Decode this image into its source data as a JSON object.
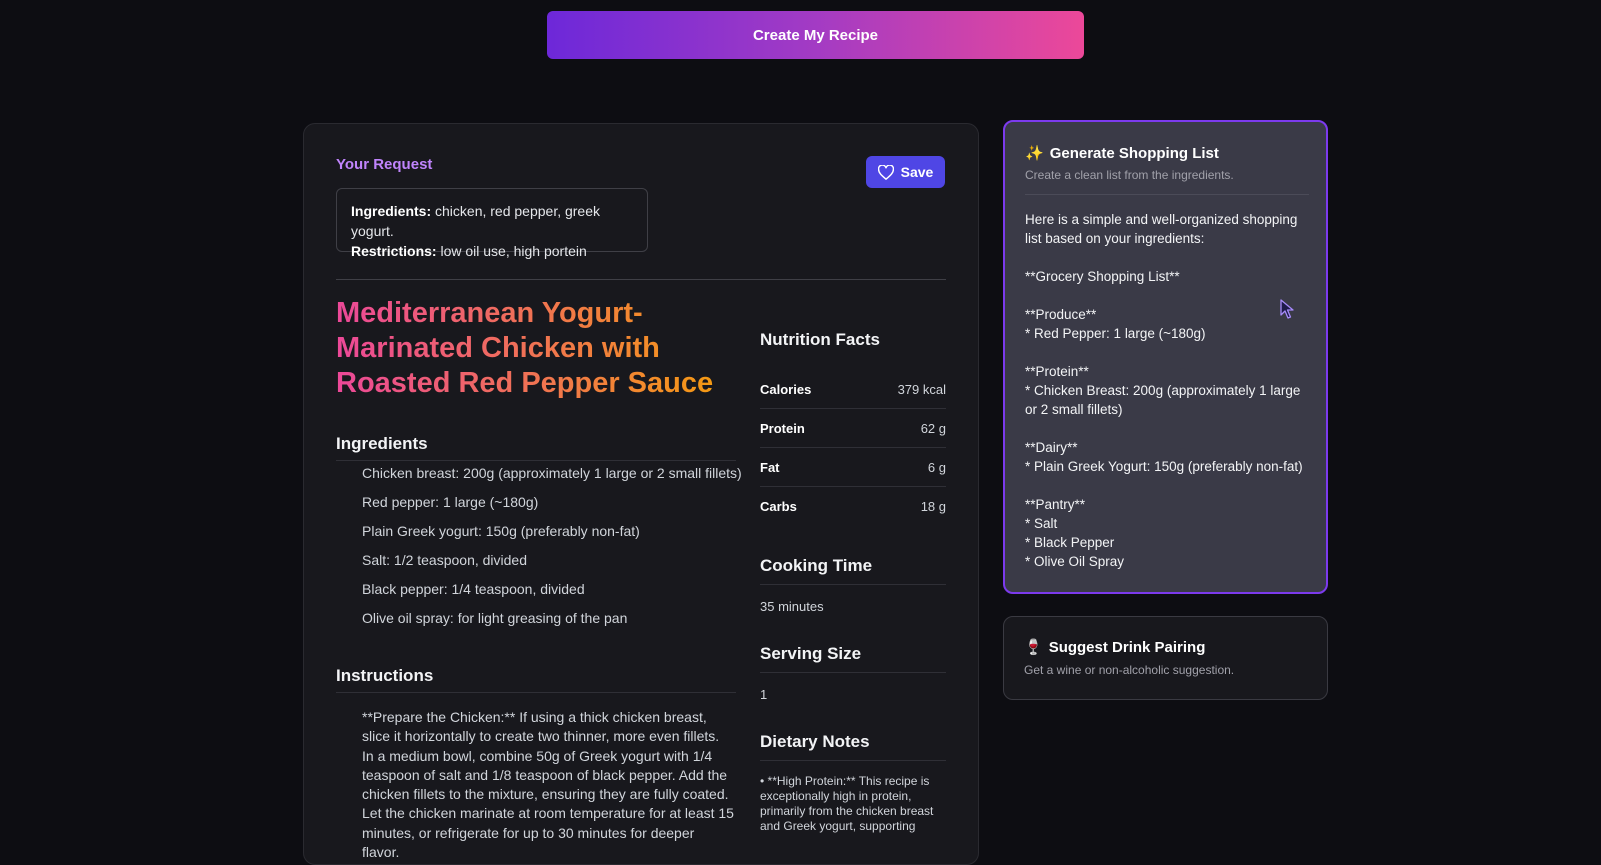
{
  "top": {
    "create_label": "Create My Recipe"
  },
  "request": {
    "label": "Your Request",
    "save_label": "Save",
    "ingredients_key": "Ingredients:",
    "ingredients_value": " chicken, red pepper, greek yogurt.",
    "restrictions_key": "Restrictions:",
    "restrictions_value": " low oil use, high portein"
  },
  "recipe": {
    "title": "Mediterranean Yogurt-Marinated Chicken with Roasted Red Pepper Sauce",
    "ingredients_heading": "Ingredients",
    "ingredients": [
      "Chicken breast: 200g (approximately 1 large or 2 small fillets)",
      "Red pepper: 1 large (~180g)",
      "Plain Greek yogurt: 150g (preferably non-fat)",
      "Salt: 1/2 teaspoon, divided",
      "Black pepper: 1/4 teaspoon, divided",
      "Olive oil spray: for light greasing of the pan"
    ],
    "instructions_heading": "Instructions",
    "instruction_1": "**Prepare the Chicken:** If using a thick chicken breast, slice it horizontally to create two thinner, more even fillets. In a medium bowl, combine 50g of Greek yogurt with 1/4 teaspoon of salt and 1/8 teaspoon of black pepper. Add the chicken fillets to the mixture, ensuring they are fully coated. Let the chicken marinate at room temperature for at least 15 minutes, or refrigerate for up to 30 minutes for deeper flavor."
  },
  "nutrition": {
    "heading": "Nutrition Facts",
    "rows": [
      {
        "label": "Calories",
        "value": "379 kcal"
      },
      {
        "label": "Protein",
        "value": "62 g"
      },
      {
        "label": "Fat",
        "value": "6 g"
      },
      {
        "label": "Carbs",
        "value": "18 g"
      }
    ],
    "cooking_heading": "Cooking Time",
    "cooking_value": "35 minutes",
    "serving_heading": "Serving Size",
    "serving_value": "1",
    "dietary_heading": "Dietary Notes",
    "dietary_text": "• **High Protein:** This recipe is exceptionally high in protein, primarily from the chicken breast and Greek yogurt, supporting"
  },
  "shopping": {
    "icon": "✨",
    "title": "Generate Shopping List",
    "subtitle": "Create a clean list from the ingredients.",
    "text": "Here is a simple and well-organized shopping list based on your ingredients:\n\n**Grocery Shopping List**\n\n**Produce**\n* Red Pepper: 1 large (~180g)\n\n**Protein**\n* Chicken Breast: 200g (approximately 1 large or 2 small fillets)\n\n**Dairy**\n* Plain Greek Yogurt: 150g (preferably non-fat)\n\n**Pantry**\n* Salt\n* Black Pepper\n* Olive Oil Spray"
  },
  "drink": {
    "icon": "🍷",
    "title": "Suggest Drink Pairing",
    "subtitle": "Get a wine or non-alcoholic suggestion."
  },
  "colors": {
    "background": "#0d0d12",
    "accent_purple": "#c084fc",
    "button_indigo": "#4f46e5",
    "active_border": "#7c3aed"
  }
}
